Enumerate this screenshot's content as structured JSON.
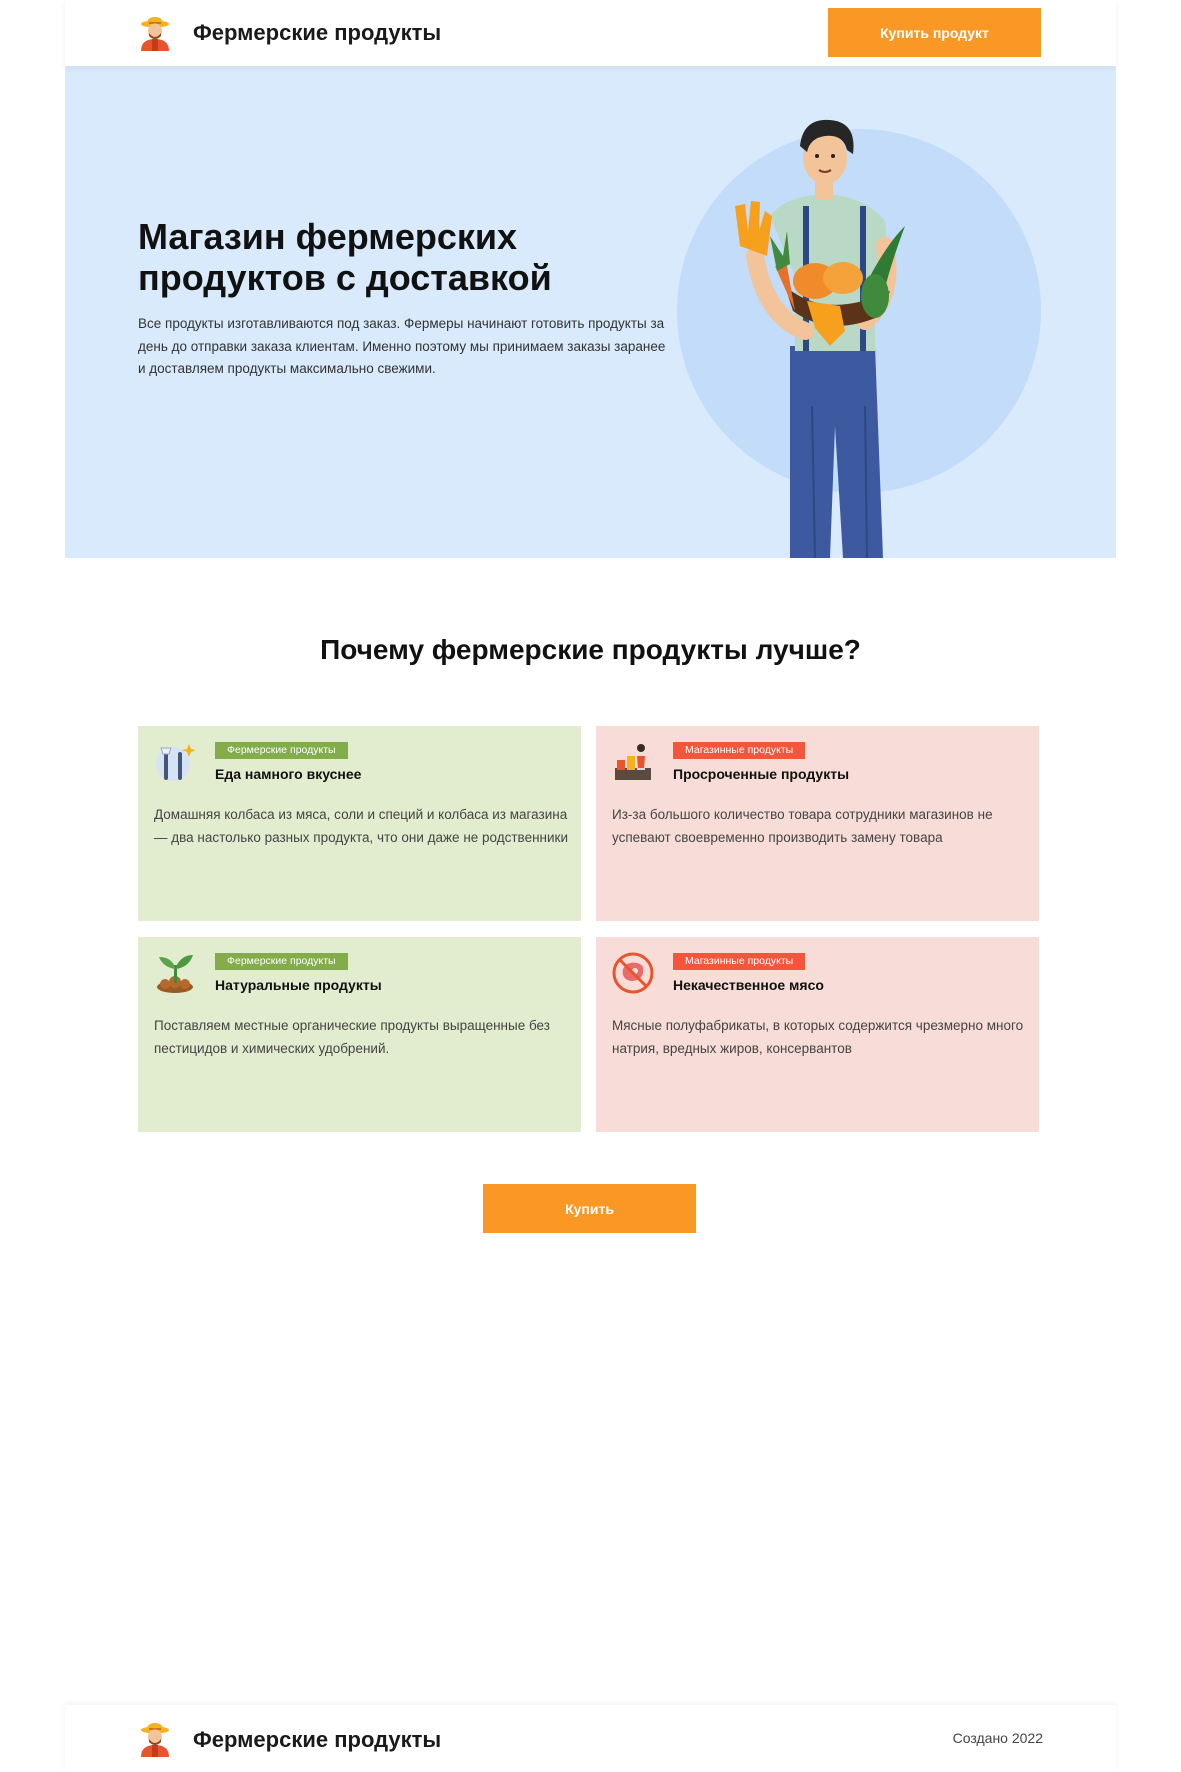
{
  "header": {
    "brand": "Фермерские продукты",
    "buy_button": "Купить продукт"
  },
  "hero": {
    "title": "Магазин фермерских продуктов с доставкой",
    "text": "Все продукты изготавливаются под заказ. Фермеры начинают готовить продукты за день до отправки заказа клиентам. Именно поэтому мы принимаем заказы заранее и доставляем продукты максимально свежими."
  },
  "section": {
    "title": "Почему фермерские продукты лучше?",
    "cards": [
      {
        "badge": "Фермерские продукты",
        "title": "Еда намного вкуснее",
        "text": "Домашняя колбаса из мяса, соли и специй и колбаса из магазина — два настолько разных продукта, что они даже не родственники",
        "icon": "farmer-tools-icon"
      },
      {
        "badge": "Магазинные продукты",
        "title": "Просроченные продукты",
        "text": "Из-за большого количество товара сотрудники магазинов не успевают своевременно производить замену товара",
        "icon": "store-shelf-icon"
      },
      {
        "badge": "Фермерские продукты",
        "title": "Натуральные продукты",
        "text": "Поставляем местные органические продукты выращенные без пестицидов и химических удобрений.",
        "icon": "sprout-icon"
      },
      {
        "badge": "Магазинные продукты",
        "title": "Некачественное мясо",
        "text": "Мясные полуфабрикаты, в которых содержится чрезмерно много натрия, вредных жиров, консервантов",
        "icon": "no-meat-icon"
      }
    ],
    "buy_button": "Купить"
  },
  "footer": {
    "brand": "Фермерские продукты",
    "copyright": "Создано 2022"
  },
  "colors": {
    "accent": "#fa9826",
    "hero_bg": "#d8eafb",
    "card_green": "#e2ecce",
    "card_red": "#f7dcd7",
    "badge_green": "#83ac4b",
    "badge_red": "#f4563b"
  }
}
